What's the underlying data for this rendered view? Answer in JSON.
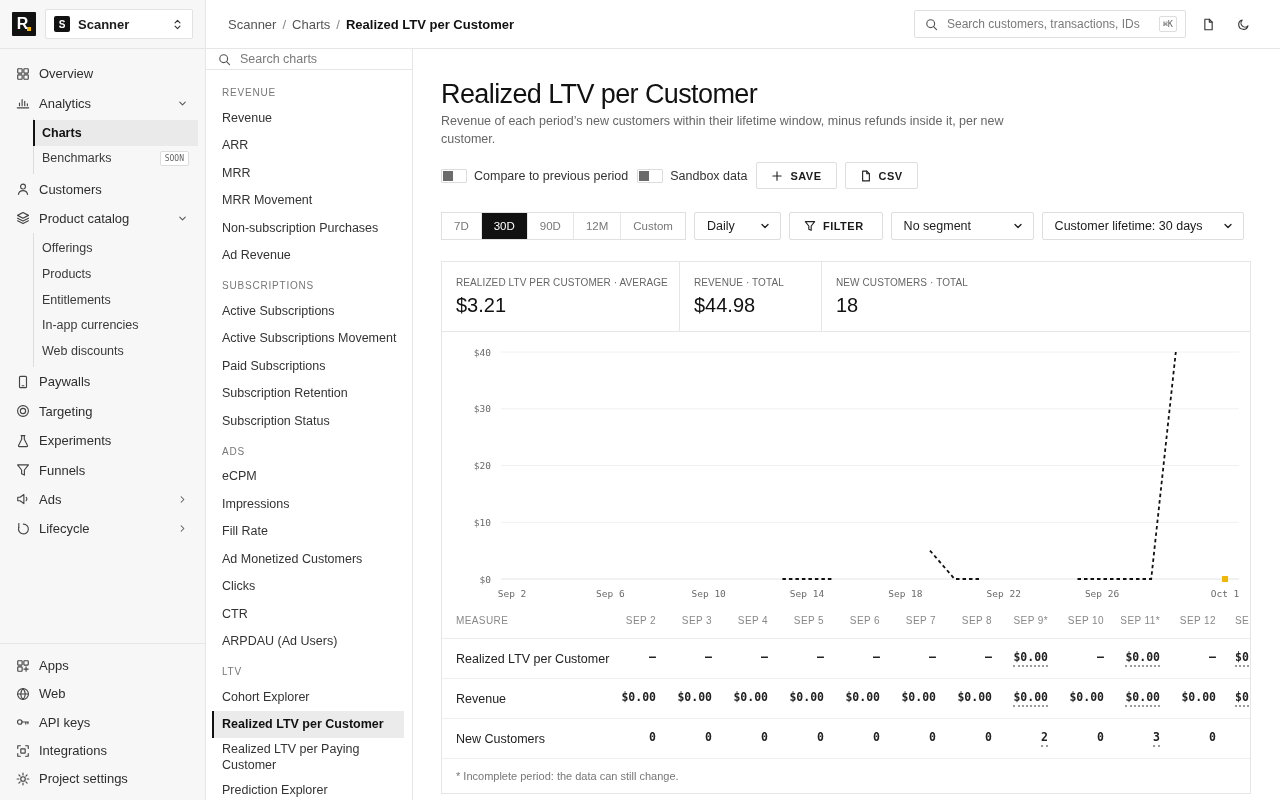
{
  "sidebar": {
    "logo": "R",
    "project": {
      "avatar": "S",
      "name": "Scanner"
    },
    "nav": [
      {
        "label": "Overview",
        "selected": false
      },
      {
        "label": "Analytics",
        "selected": false,
        "expanded": true,
        "children": [
          {
            "label": "Charts",
            "selected": true
          },
          {
            "label": "Benchmarks",
            "selected": false,
            "badge": "SOON"
          }
        ]
      },
      {
        "label": "Customers",
        "selected": false
      },
      {
        "label": "Product catalog",
        "selected": false,
        "expanded": true,
        "children": [
          {
            "label": "Offerings",
            "selected": false
          },
          {
            "label": "Products",
            "selected": false
          },
          {
            "label": "Entitlements",
            "selected": false
          },
          {
            "label": "In-app currencies",
            "selected": false
          },
          {
            "label": "Web discounts",
            "selected": false
          }
        ]
      },
      {
        "label": "Paywalls",
        "selected": false
      },
      {
        "label": "Targeting",
        "selected": false
      },
      {
        "label": "Experiments",
        "selected": false
      },
      {
        "label": "Funnels",
        "selected": false
      },
      {
        "label": "Ads",
        "selected": false,
        "expanded": false
      },
      {
        "label": "Lifecycle",
        "selected": false,
        "expanded": false
      }
    ],
    "bottom_nav": [
      {
        "label": "Apps",
        "selected": false
      },
      {
        "label": "Web",
        "selected": false
      },
      {
        "label": "API keys",
        "selected": false
      },
      {
        "label": "Integrations",
        "selected": false
      },
      {
        "label": "Project settings",
        "selected": false
      }
    ]
  },
  "topbar": {
    "breadcrumb": {
      "separator": "/",
      "items": [
        "Scanner",
        "Charts",
        "Realized LTV per Customer"
      ]
    },
    "search": {
      "placeholder": "Search customers, transactions, IDs",
      "shortcut": "⌘K"
    }
  },
  "chart_list": {
    "search_placeholder": "Search charts",
    "sections": [
      {
        "title": "REVENUE",
        "items": [
          {
            "label": "Revenue",
            "selected": false
          },
          {
            "label": "ARR",
            "selected": false
          },
          {
            "label": "MRR",
            "selected": false
          },
          {
            "label": "MRR Movement",
            "selected": false
          },
          {
            "label": "Non-subscription Purchases",
            "selected": false
          },
          {
            "label": "Ad Revenue",
            "selected": false
          }
        ]
      },
      {
        "title": "SUBSCRIPTIONS",
        "items": [
          {
            "label": "Active Subscriptions",
            "selected": false
          },
          {
            "label": "Active Subscriptions Movement",
            "selected": false
          },
          {
            "label": "Paid Subscriptions",
            "selected": false
          },
          {
            "label": "Subscription Retention",
            "selected": false
          },
          {
            "label": "Subscription Status",
            "selected": false
          }
        ]
      },
      {
        "title": "ADS",
        "items": [
          {
            "label": "eCPM",
            "selected": false
          },
          {
            "label": "Impressions",
            "selected": false
          },
          {
            "label": "Fill Rate",
            "selected": false
          },
          {
            "label": "Ad Monetized Customers",
            "selected": false
          },
          {
            "label": "Clicks",
            "selected": false
          },
          {
            "label": "CTR",
            "selected": false
          },
          {
            "label": "ARPDAU (Ad Users)",
            "selected": false
          }
        ]
      },
      {
        "title": "LTV",
        "items": [
          {
            "label": "Cohort Explorer",
            "selected": false
          },
          {
            "label": "Realized LTV per Customer",
            "selected": true
          },
          {
            "label": "Realized LTV per Paying Customer",
            "selected": false
          },
          {
            "label": "Prediction Explorer",
            "selected": false
          }
        ]
      }
    ]
  },
  "page": {
    "title": "Realized LTV per Customer",
    "description": "Revenue of each period’s new customers within their lifetime window, minus refunds inside it, per new customer.",
    "toggles": [
      {
        "label": "Compare to previous period",
        "on": false
      },
      {
        "label": "Sandbox data",
        "on": false
      }
    ],
    "actions": [
      {
        "label": "SAVE"
      },
      {
        "label": "CSV"
      }
    ],
    "ranges": [
      {
        "label": "7D",
        "selected": false
      },
      {
        "label": "30D",
        "selected": true
      },
      {
        "label": "90D",
        "selected": false
      },
      {
        "label": "12M",
        "selected": false
      },
      {
        "label": "Custom",
        "selected": false
      }
    ],
    "interval": "Daily",
    "filter": "FILTER",
    "segment": "No segment",
    "lifetime": "Customer lifetime: 30 days"
  },
  "card": {
    "stats": [
      {
        "label": "REALIZED LTV PER CUSTOMER · AVERAGE",
        "value": "$3.21"
      },
      {
        "label": "REVENUE · TOTAL",
        "value": "$44.98"
      },
      {
        "label": "NEW CUSTOMERS · TOTAL",
        "value": "18"
      }
    ],
    "chart_data": {
      "type": "line",
      "grid": true,
      "categories": [
        "Sep 2",
        null,
        null,
        null,
        "Sep 6",
        null,
        null,
        null,
        "Sep 10",
        null,
        null,
        null,
        "Sep 14",
        null,
        null,
        null,
        "Sep 18",
        null,
        null,
        null,
        "Sep 22",
        null,
        null,
        null,
        "Sep 26",
        null,
        null,
        null,
        null,
        "Oct 1"
      ],
      "ylim": [
        0,
        40
      ],
      "yticks": [
        {
          "value": 0,
          "label": "$0"
        },
        {
          "value": 10,
          "label": "$10"
        },
        {
          "value": 20,
          "label": "$20"
        },
        {
          "value": 30,
          "label": "$30"
        },
        {
          "value": 40,
          "label": "$40"
        }
      ],
      "series": [
        {
          "color": "#111111",
          "line_style": "dashed",
          "values": [
            null,
            null,
            null,
            null,
            null,
            null,
            null,
            null,
            null,
            null,
            null,
            0,
            0,
            0,
            null,
            null,
            null,
            5,
            0,
            0,
            null,
            null,
            null,
            0,
            0,
            0,
            0,
            40,
            null,
            null
          ]
        },
        {
          "color": "#f2b705",
          "marker": "square",
          "values": [
            null,
            null,
            null,
            null,
            null,
            null,
            null,
            null,
            null,
            null,
            null,
            null,
            null,
            null,
            null,
            null,
            null,
            null,
            null,
            null,
            null,
            null,
            null,
            null,
            null,
            null,
            null,
            null,
            null,
            0
          ]
        }
      ]
    },
    "table": {
      "columns": [
        "MEASURE",
        "SEP 2",
        "SEP 3",
        "SEP 4",
        "SEP 5",
        "SEP 6",
        "SEP 7",
        "SEP 8",
        "SEP 9*",
        "SEP 10",
        "SEP 11*",
        "SEP 12",
        "SE"
      ],
      "rows": [
        {
          "cells": [
            "Realized LTV per Customer",
            {
              "text": "–",
              "incomplete": false
            },
            {
              "text": "–",
              "incomplete": false
            },
            {
              "text": "–",
              "incomplete": false
            },
            {
              "text": "–",
              "incomplete": false
            },
            {
              "text": "–",
              "incomplete": false
            },
            {
              "text": "–",
              "incomplete": false
            },
            {
              "text": "–",
              "incomplete": false
            },
            {
              "text": "$0.00",
              "incomplete": true
            },
            {
              "text": "–",
              "incomplete": false
            },
            {
              "text": "$0.00",
              "incomplete": true
            },
            {
              "text": "–",
              "incomplete": false
            },
            {
              "text": "$0",
              "incomplete": true
            }
          ]
        },
        {
          "cells": [
            "Revenue",
            {
              "text": "$0.00",
              "incomplete": false
            },
            {
              "text": "$0.00",
              "incomplete": false
            },
            {
              "text": "$0.00",
              "incomplete": false
            },
            {
              "text": "$0.00",
              "incomplete": false
            },
            {
              "text": "$0.00",
              "incomplete": false
            },
            {
              "text": "$0.00",
              "incomplete": false
            },
            {
              "text": "$0.00",
              "incomplete": false
            },
            {
              "text": "$0.00",
              "incomplete": true
            },
            {
              "text": "$0.00",
              "incomplete": false
            },
            {
              "text": "$0.00",
              "incomplete": true
            },
            {
              "text": "$0.00",
              "incomplete": false
            },
            {
              "text": "$0",
              "incomplete": true
            }
          ]
        },
        {
          "cells": [
            "New Customers",
            {
              "text": "0",
              "incomplete": false
            },
            {
              "text": "0",
              "incomplete": false
            },
            {
              "text": "0",
              "incomplete": false
            },
            {
              "text": "0",
              "incomplete": false
            },
            {
              "text": "0",
              "incomplete": false
            },
            {
              "text": "0",
              "incomplete": false
            },
            {
              "text": "0",
              "incomplete": false
            },
            {
              "text": "2",
              "incomplete": true
            },
            {
              "text": "0",
              "incomplete": false
            },
            {
              "text": "3",
              "incomplete": true
            },
            {
              "text": "0",
              "incomplete": false
            }
          ]
        }
      ],
      "note": "* Incomplete period: the data can still change."
    }
  }
}
